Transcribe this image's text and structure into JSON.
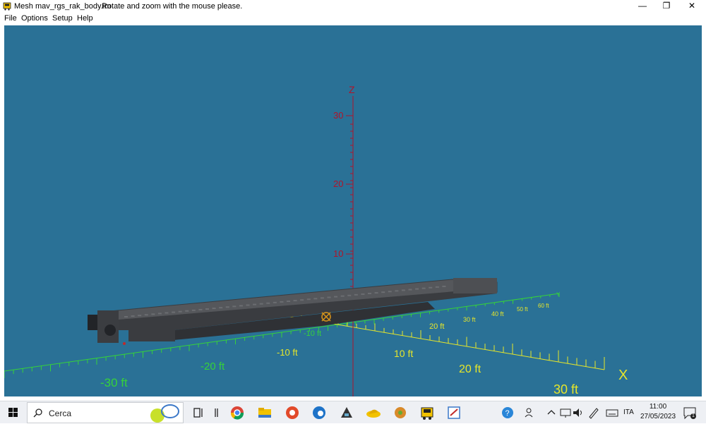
{
  "window": {
    "title": "Mesh mav_rgs_rak_body.im",
    "hint": "Rotate and zoom with the mouse please.",
    "minimize_glyph": "—",
    "restore_glyph": "❐",
    "close_glyph": "✕"
  },
  "menu": [
    "File",
    "Options",
    "Setup",
    "Help"
  ],
  "viewport": {
    "background": "#2a7196",
    "axes": {
      "z": {
        "label": "Z",
        "color": "#b0142a",
        "ticks": [
          "10",
          "20",
          "30"
        ]
      },
      "x": {
        "label": "X",
        "color": "#e6e62a",
        "ticks": [
          "-10 ft",
          "10 ft",
          "20 ft",
          "30 ft"
        ]
      },
      "y": {
        "label": "Y",
        "color": "#36d23a",
        "ticks": [
          "-30 ft",
          "-20 ft",
          "-10 ft",
          "20 ft",
          "30 ft",
          "40 ft",
          "50 ft",
          "60 ft"
        ]
      }
    },
    "model": {
      "type": "flat wagon mesh",
      "color": "#4c4e52"
    }
  },
  "taskbar": {
    "search_placeholder": "Cerca",
    "icons": [
      "windows-start-icon",
      "search-icon",
      "task-view-icon",
      "chrome-icon",
      "file-explorer-icon",
      "app-icon",
      "edge-icon",
      "app-icon",
      "app-icon",
      "app-icon",
      "train-sim-icon",
      "app-icon"
    ],
    "tray": {
      "language": "ITA",
      "time": "11:00",
      "date": "27/05/2023",
      "notification_count": "1"
    }
  }
}
